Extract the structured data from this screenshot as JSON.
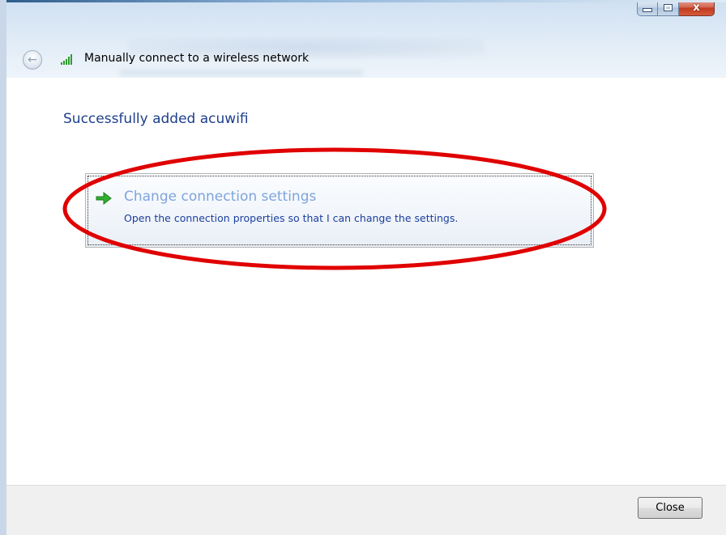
{
  "window": {
    "title": "Manually connect to a wireless network",
    "close_glyph": "x"
  },
  "content": {
    "heading": "Successfully added acuwifi",
    "command_link": {
      "title": "Change connection settings",
      "description": "Open the connection properties so that I can change the settings.",
      "icon": "green-arrow-icon"
    }
  },
  "footer": {
    "close_label": "Close"
  },
  "colors": {
    "heading": "#1e3f8c",
    "link_title": "#7ea4dd",
    "link_desc": "#1a3e9e",
    "annotation": "#e00000"
  }
}
